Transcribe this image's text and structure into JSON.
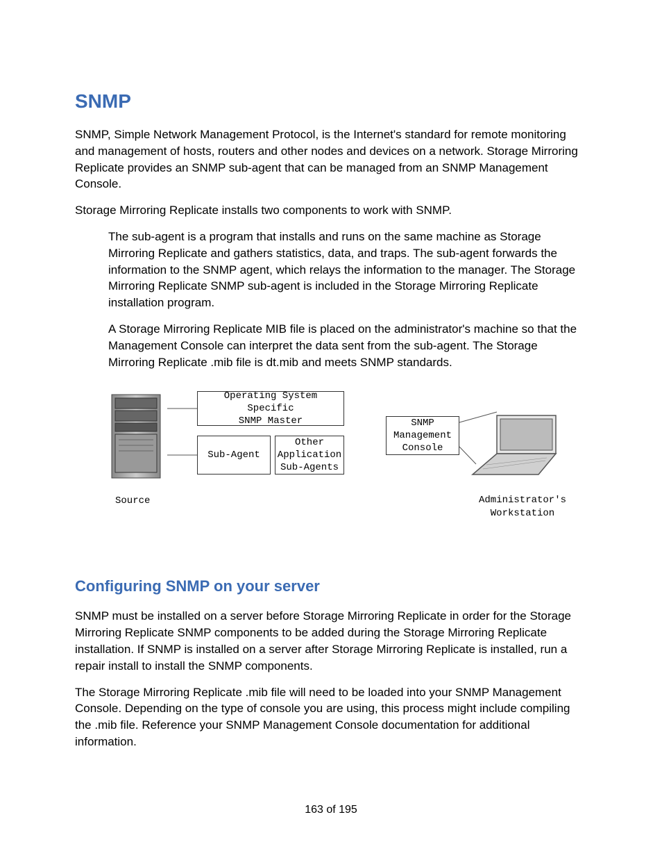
{
  "heading1": "SNMP",
  "para1": "SNMP, Simple Network Management Protocol, is the Internet's standard for remote monitoring and management of hosts, routers and other nodes and devices on a network. Storage Mirroring Replicate provides an SNMP sub-agent that can be managed from an SNMP Management Console.",
  "para2": "Storage Mirroring Replicate installs two components to work with SNMP.",
  "para3": "The sub-agent is a program that installs and runs on the same machine as Storage Mirroring Replicate and gathers statistics, data, and traps. The sub-agent forwards the information to the SNMP agent, which relays the information to the manager. The Storage Mirroring Replicate SNMP sub-agent is included in the Storage Mirroring Replicate installation program.",
  "para4": "A Storage Mirroring Replicate MIB file is placed on the administrator's machine so that the Management Console can interpret the data sent from the sub-agent. The Storage Mirroring Replicate .mib file is dt.mib and meets SNMP standards.",
  "heading2": "Configuring SNMP on your server",
  "para5": "SNMP must be installed on a server before Storage Mirroring Replicate in order for the Storage Mirroring Replicate SNMP components to be added during the Storage Mirroring Replicate installation. If SNMP is installed on a server after Storage Mirroring Replicate is installed, run a repair install to install the SNMP components.",
  "para6": "The Storage Mirroring Replicate .mib file will need to be loaded into your SNMP Management Console. Depending on the type of console you are using, this process might include compiling the .mib file. Reference your SNMP Management Console documentation for additional information.",
  "diagram": {
    "master_line1": "Operating System Specific",
    "master_line2": "SNMP Master",
    "subagent": "Sub-Agent",
    "other_line1": "Other",
    "other_line2": "Application",
    "other_line3": "Sub-Agents",
    "mgmt_line1": "SNMP",
    "mgmt_line2": "Management",
    "mgmt_line3": "Console",
    "source_label": "Source",
    "admin_label_line1": "Administrator's",
    "admin_label_line2": "Workstation"
  },
  "footer": "163 of 195"
}
